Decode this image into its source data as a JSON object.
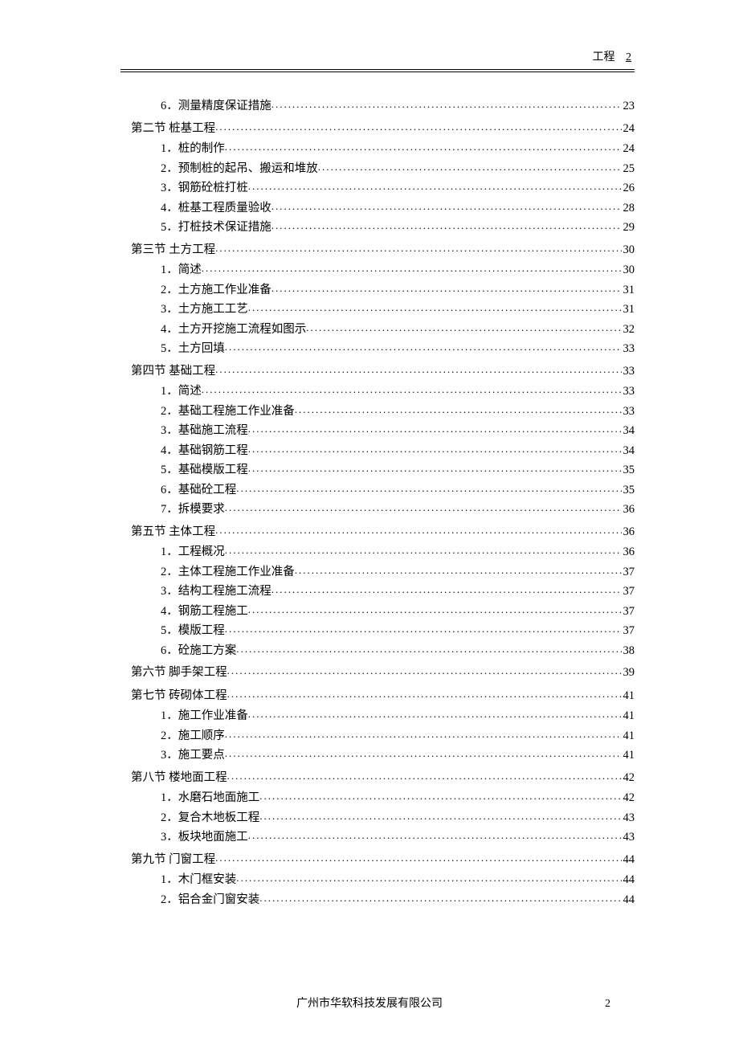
{
  "header": {
    "title": "工程",
    "page": "2"
  },
  "toc": [
    {
      "level": "sub",
      "label": "6．测量精度保证措施",
      "page": "23"
    },
    {
      "level": "section",
      "label": "第二节  桩基工程",
      "page": "24"
    },
    {
      "level": "sub",
      "label": "1．桩的制作",
      "page": "24"
    },
    {
      "level": "sub",
      "label": "2．预制桩的起吊、搬运和堆放",
      "page": "25"
    },
    {
      "level": "sub",
      "label": "3．钢筋砼桩打桩",
      "page": "26"
    },
    {
      "level": "sub",
      "label": "4．桩基工程质量验收",
      "page": "28"
    },
    {
      "level": "sub",
      "label": "5．打桩技术保证措施",
      "page": "29"
    },
    {
      "level": "section",
      "label": "第三节  土方工程",
      "page": "30"
    },
    {
      "level": "sub",
      "label": "1．简述",
      "page": "30"
    },
    {
      "level": "sub",
      "label": "2．土方施工作业准备",
      "page": "31"
    },
    {
      "level": "sub",
      "label": "3．土方施工工艺",
      "page": "31"
    },
    {
      "level": "sub",
      "label": "4．土方开挖施工流程如图示",
      "page": "32"
    },
    {
      "level": "sub",
      "label": "5．土方回填",
      "page": "33"
    },
    {
      "level": "section",
      "label": "第四节  基础工程",
      "page": "33"
    },
    {
      "level": "sub",
      "label": "1．简述",
      "page": "33"
    },
    {
      "level": "sub",
      "label": "2．基础工程施工作业准备",
      "page": "33"
    },
    {
      "level": "sub",
      "label": "3．基础施工流程",
      "page": "34"
    },
    {
      "level": "sub",
      "label": "4．基础钢筋工程",
      "page": "34"
    },
    {
      "level": "sub",
      "label": "5．基础模版工程",
      "page": "35"
    },
    {
      "level": "sub",
      "label": "6．基础砼工程",
      "page": "35"
    },
    {
      "level": "sub",
      "label": "7．拆模要求",
      "page": "36"
    },
    {
      "level": "section",
      "label": "第五节  主体工程",
      "page": "36"
    },
    {
      "level": "sub",
      "label": "1．工程概况",
      "page": "36"
    },
    {
      "level": "sub",
      "label": "2．主体工程施工作业准备",
      "page": "37"
    },
    {
      "level": "sub",
      "label": "3．结构工程施工流程",
      "page": "37"
    },
    {
      "level": "sub",
      "label": "4．钢筋工程施工",
      "page": "37"
    },
    {
      "level": "sub",
      "label": "5．模版工程",
      "page": "37"
    },
    {
      "level": "sub",
      "label": "6．砼施工方案",
      "page": "38"
    },
    {
      "level": "section",
      "label": "第六节  脚手架工程",
      "page": "39"
    },
    {
      "level": "section",
      "label": "第七节  砖砌体工程",
      "page": "41"
    },
    {
      "level": "sub",
      "label": "1．施工作业准备",
      "page": "41"
    },
    {
      "level": "sub",
      "label": "2．施工顺序",
      "page": "41"
    },
    {
      "level": "sub",
      "label": "3．施工要点",
      "page": "41"
    },
    {
      "level": "section",
      "label": "第八节  楼地面工程",
      "page": "42"
    },
    {
      "level": "sub",
      "label": "1．水磨石地面施工",
      "page": "42"
    },
    {
      "level": "sub",
      "label": "2．复合木地板工程",
      "page": "43"
    },
    {
      "level": "sub",
      "label": "3．板块地面施工",
      "page": "43"
    },
    {
      "level": "section",
      "label": "第九节  门窗工程",
      "page": "44"
    },
    {
      "level": "sub",
      "label": "1．木门框安装",
      "page": "44"
    },
    {
      "level": "sub",
      "label": "2．铝合金门窗安装",
      "page": "44"
    }
  ],
  "footer": {
    "company": "广州市华软科技发展有限公司",
    "page": "2"
  }
}
